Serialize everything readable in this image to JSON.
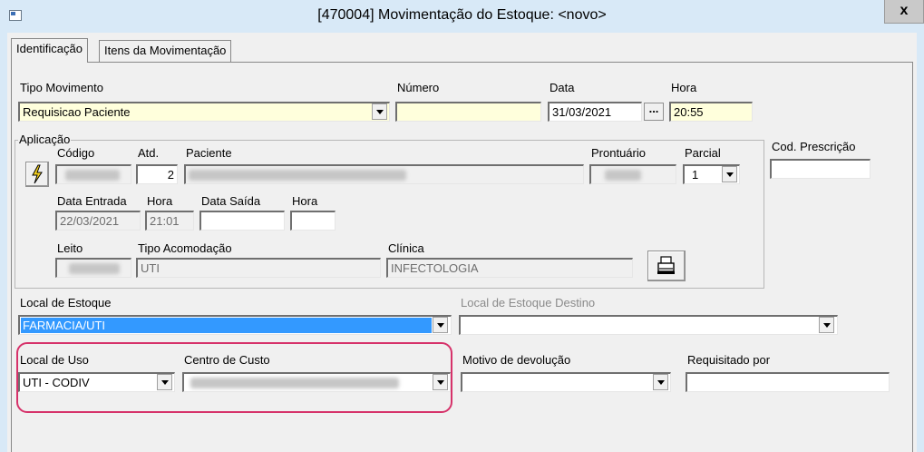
{
  "window": {
    "title": "[470004]  Movimentação do Estoque: <novo>",
    "close_label": "x"
  },
  "tabs": [
    {
      "label": "Identificação"
    },
    {
      "label": "Itens da Movimentação"
    }
  ],
  "form": {
    "tipo_movimento": {
      "label": "Tipo Movimento",
      "value": "Requisicao Paciente"
    },
    "numero": {
      "label": "Número",
      "value": ""
    },
    "data": {
      "label": "Data",
      "value": "31/03/2021",
      "button": "..."
    },
    "hora": {
      "label": "Hora",
      "value": "20:55"
    },
    "aplicacao": {
      "caption": "Aplicação",
      "codigo": {
        "label": "Código",
        "value": ""
      },
      "atd": {
        "label": "Atd.",
        "value": "2"
      },
      "paciente": {
        "label": "Paciente",
        "value": ""
      },
      "prontuario": {
        "label": "Prontuário",
        "value": ""
      },
      "parcial": {
        "label": "Parcial",
        "value": "1"
      },
      "data_entrada": {
        "label": "Data Entrada",
        "value": "22/03/2021"
      },
      "hora_entrada": {
        "label": "Hora",
        "value": "21:01"
      },
      "data_saida": {
        "label": "Data Saída",
        "value": ""
      },
      "hora_saida": {
        "label": "Hora",
        "value": ""
      },
      "leito": {
        "label": "Leito",
        "value": ""
      },
      "tipo_acomodacao": {
        "label": "Tipo Acomodação",
        "value": "UTI"
      },
      "clinica": {
        "label": "Clínica",
        "value": "INFECTOLOGIA"
      }
    },
    "cod_prescricao": {
      "label": "Cod. Prescrição",
      "value": ""
    },
    "local_estoque": {
      "label": "Local de Estoque",
      "value": "FARMACIA/UTI"
    },
    "local_estoque_destino": {
      "label": "Local de Estoque Destino",
      "value": ""
    },
    "local_uso": {
      "label": "Local de Uso",
      "value": "UTI - CODIV"
    },
    "centro_custo": {
      "label": "Centro de Custo",
      "value": ""
    },
    "motivo_devolucao": {
      "label": "Motivo de devolução",
      "value": ""
    },
    "requisitado_por": {
      "label": "Requisitado por",
      "value": ""
    }
  },
  "colors": {
    "highlight": "#d6326a",
    "yellow_field": "#ffffdc",
    "selection": "#3399ff"
  }
}
